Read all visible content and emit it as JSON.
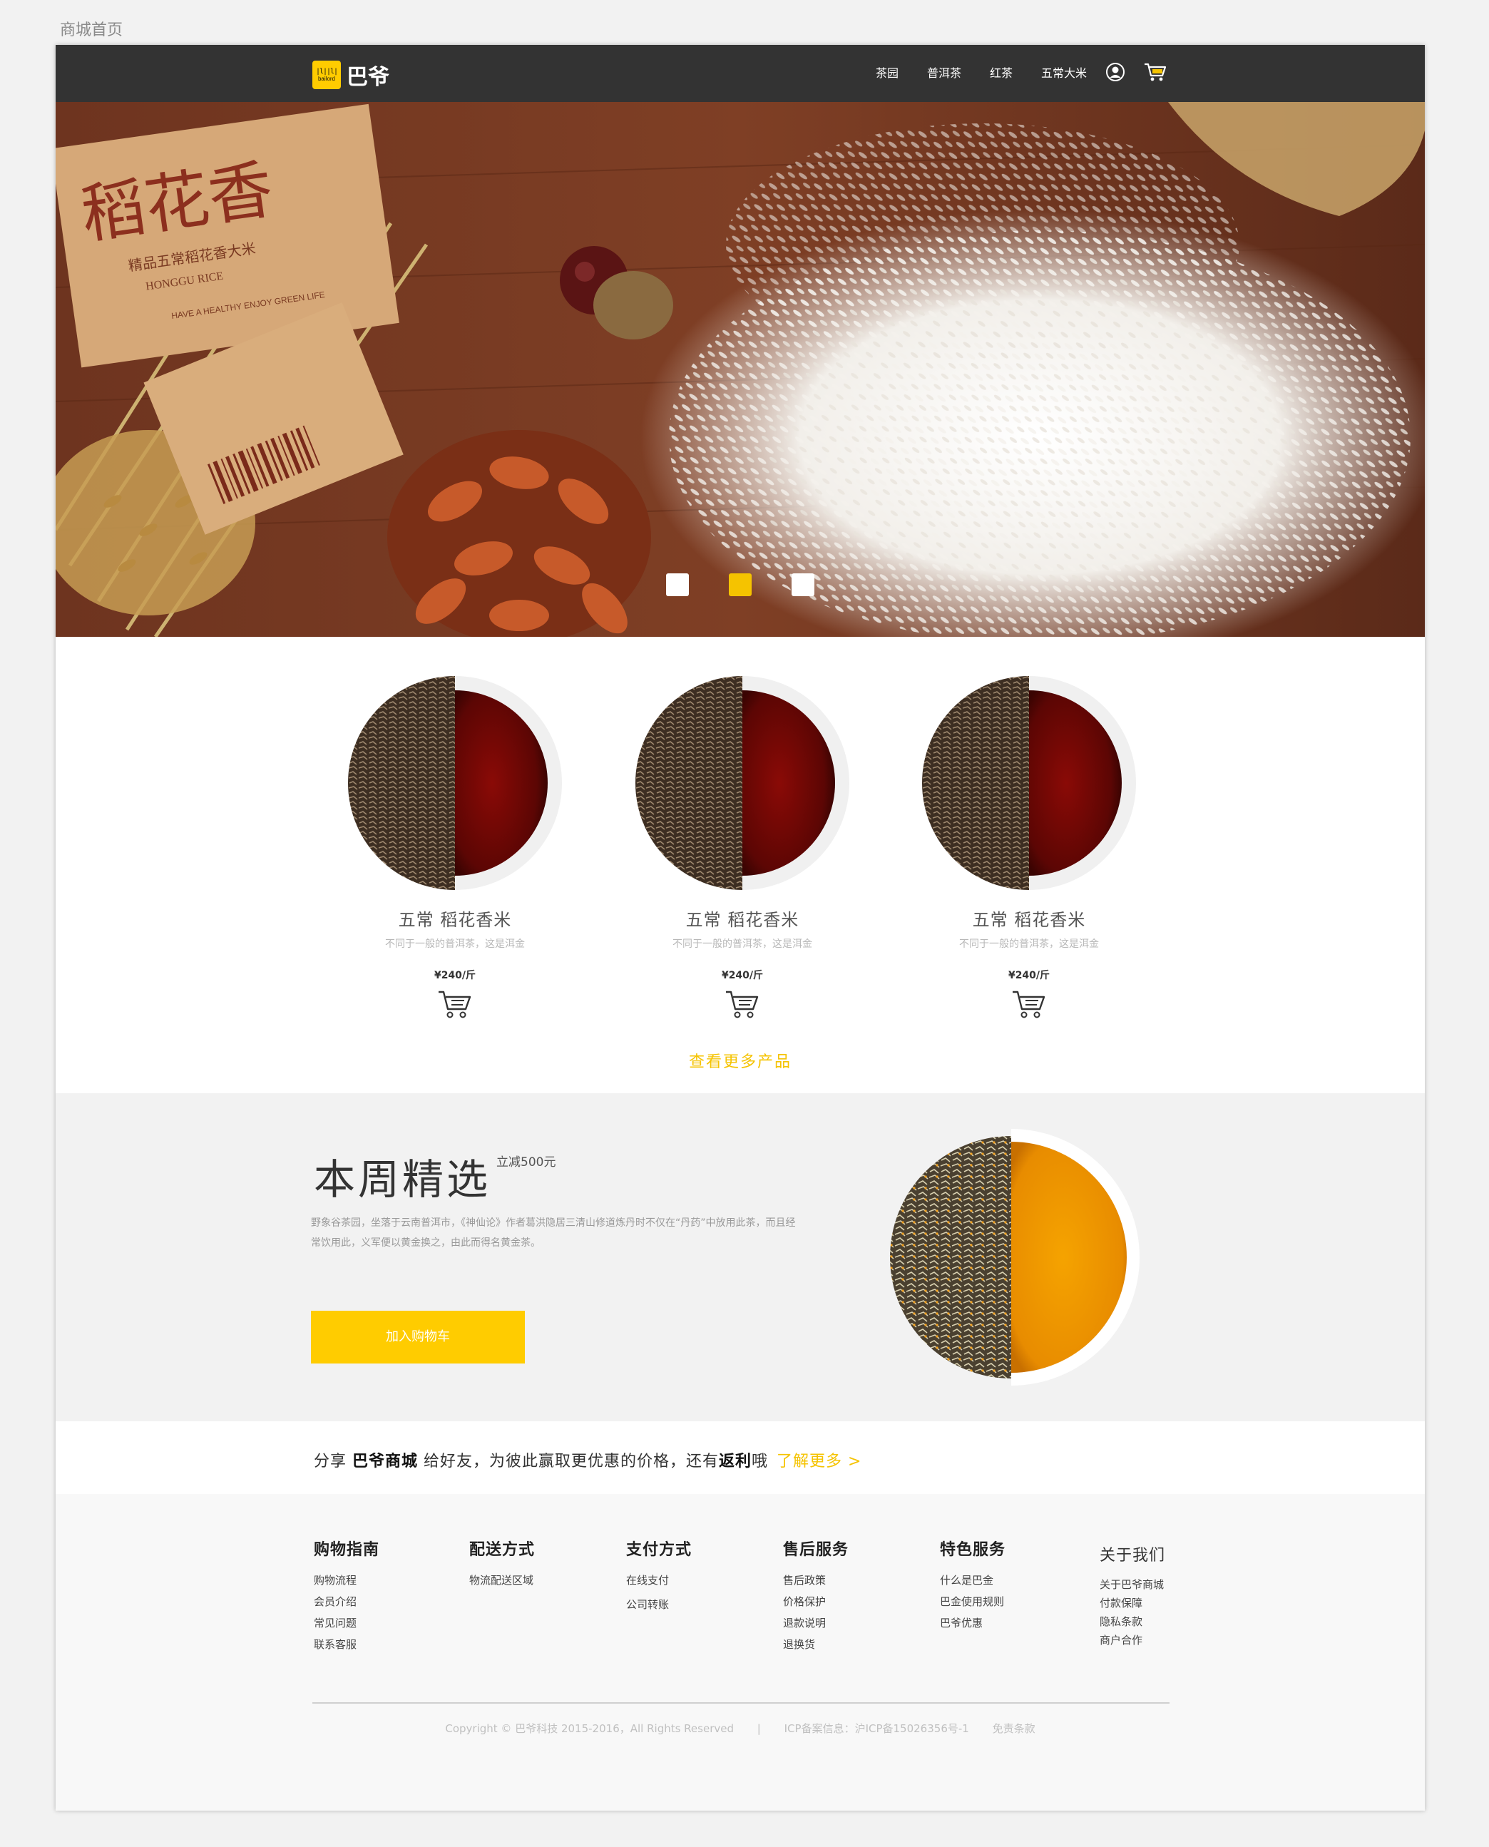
{
  "page_label": "商城首页",
  "header": {
    "logo_text": "巴爷",
    "logo_sub": "bailord",
    "nav": [
      "茶园",
      "普洱茶",
      "红茶",
      "五常大米"
    ],
    "icons": [
      "user-icon",
      "cart-icon"
    ]
  },
  "hero": {
    "slides": 3,
    "active_slide": 2,
    "accent": "#f5c300"
  },
  "products": {
    "items": [
      {
        "name": "五常  稻花香米",
        "desc": "不同于一般的普洱茶，这是洱金",
        "price": "¥240/斤"
      },
      {
        "name": "五常  稻花香米",
        "desc": "不同于一般的普洱茶，这是洱金",
        "price": "¥240/斤"
      },
      {
        "name": "五常  稻花香米",
        "desc": "不同于一般的普洱茶，这是洱金",
        "price": "¥240/斤"
      }
    ],
    "more_label": "查看更多产品"
  },
  "weekly": {
    "title": "本周精选",
    "badge": "立减500元",
    "desc": "野象谷茶园，坐落于云南普洱市，《神仙论》作者葛洪隐居三清山修道炼丹时不仅在“丹药”中放用此茶，而且经常饮用此，义军便以黄金换之，由此而得名黄金茶。",
    "button": "加入购物车"
  },
  "share": {
    "p1": "分享 ",
    "brand": "巴爷商城",
    "p2": " 给好友，为彼此赢取更优惠的价格，还有",
    "rebate": "返利",
    "p3": "哦",
    "link": "了解更多 >"
  },
  "footer": {
    "columns": [
      {
        "title": "购物指南",
        "items": [
          "购物流程",
          "会员介绍",
          "常见问题",
          "联系客服"
        ]
      },
      {
        "title": "配送方式",
        "items": [
          "物流配送区域"
        ]
      },
      {
        "title": "支付方式",
        "items": [
          "在线支付",
          "公司转账"
        ]
      },
      {
        "title": "售后服务",
        "items": [
          "售后政策",
          "价格保护",
          "退款说明",
          "退换货"
        ]
      },
      {
        "title": "特色服务",
        "items": [
          "什么是巴金",
          "巴金使用规则",
          "巴爷优惠"
        ]
      },
      {
        "title": "关于我们",
        "items": [
          "关于巴爷商城",
          "付款保障",
          "隐私条款",
          "商户合作"
        ]
      }
    ],
    "copyright": "Copyright © 巴爷科技 2015-2016，All Rights Reserved",
    "separator": "|",
    "icp": "ICP备案信息：沪ICP备15026356号-1",
    "disclaimer": "免责条款"
  }
}
